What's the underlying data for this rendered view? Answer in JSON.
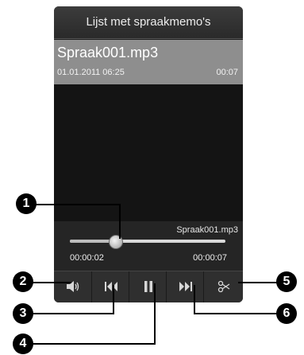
{
  "title_bar": {
    "title": "Lijst met spraakmemo's"
  },
  "selected_file": {
    "name": "Spraak001.mp3",
    "date": "01.01.2011 06:25",
    "duration": "00:07"
  },
  "player": {
    "file_name": "Spraak001.mp3",
    "elapsed": "00:00:02",
    "total": "00:00:07",
    "progress_fraction": 0.29
  },
  "controls": [
    {
      "name": "volume",
      "icon": "volume-icon"
    },
    {
      "name": "previous",
      "icon": "previous-icon"
    },
    {
      "name": "pause",
      "icon": "pause-icon"
    },
    {
      "name": "next",
      "icon": "next-icon"
    },
    {
      "name": "trim",
      "icon": "scissors-icon"
    }
  ],
  "callouts": [
    "1",
    "2",
    "3",
    "4",
    "5",
    "6"
  ]
}
